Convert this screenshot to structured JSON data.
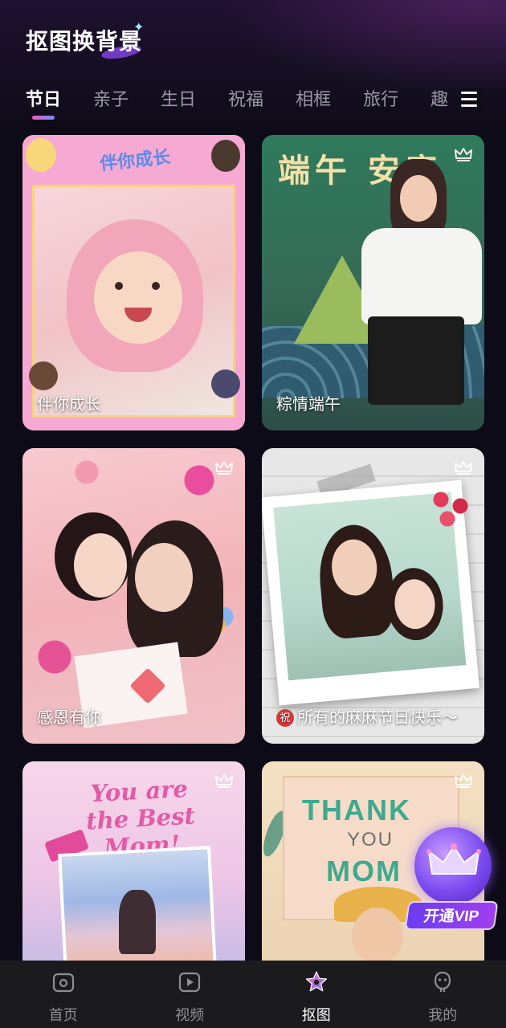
{
  "header": {
    "title": "抠图换背景"
  },
  "tabs": [
    {
      "label": "节日",
      "active": true
    },
    {
      "label": "亲子",
      "active": false
    },
    {
      "label": "生日",
      "active": false
    },
    {
      "label": "祝福",
      "active": false
    },
    {
      "label": "相框",
      "active": false
    },
    {
      "label": "旅行",
      "active": false
    },
    {
      "label": "趣",
      "active": false
    }
  ],
  "cards": [
    {
      "caption": "伴你成长",
      "art": "伴你成长",
      "premium": false
    },
    {
      "caption": "粽情端午",
      "art": "端午 安康",
      "premium": true
    },
    {
      "caption": "感恩有你",
      "premium": true
    },
    {
      "caption": "所有的麻麻节日快乐～",
      "badge": "祝",
      "premium": true
    },
    {
      "art": "You are the Best Mom!",
      "premium": true
    },
    {
      "art": [
        "THANK",
        "YOU",
        "MOM"
      ],
      "premium": true
    }
  ],
  "vip": {
    "label": "开通VIP"
  },
  "bottom_nav": [
    {
      "label": "首页",
      "icon": "home-icon",
      "active": false
    },
    {
      "label": "视频",
      "icon": "video-play-icon",
      "active": false
    },
    {
      "label": "抠图",
      "icon": "star-cutout-icon",
      "active": true
    },
    {
      "label": "我的",
      "icon": "profile-icon",
      "active": false
    }
  ],
  "colors": {
    "background": "#0e0b18",
    "tab_indicator_start": "#f25bb6",
    "tab_indicator_end": "#6f8bff",
    "nav_background": "#1b1b1d",
    "vip_purple": "#7c4bf0"
  }
}
